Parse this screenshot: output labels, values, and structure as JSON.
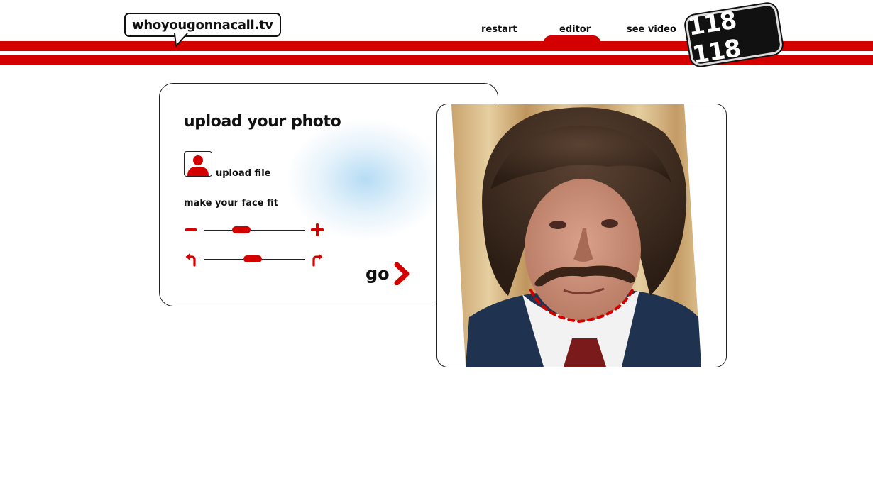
{
  "site": {
    "logo_text": "whoyougonnacall.tv",
    "badge_text": "118 118"
  },
  "nav": {
    "items": [
      {
        "label": "restart"
      },
      {
        "label": "editor"
      },
      {
        "label": "see video"
      }
    ]
  },
  "upload_panel": {
    "title": "upload your photo",
    "upload_label": "upload file",
    "fit_label": "make your face fit",
    "zoom_slider_value": 0.34,
    "rotate_slider_value": 0.48,
    "go_label": "go"
  },
  "colors": {
    "brand_red": "#d40000",
    "text": "#111111",
    "glow_blue": "#add8f3"
  },
  "icons": [
    "user-icon",
    "minus-icon",
    "plus-icon",
    "rotate-left-icon",
    "rotate-right-icon",
    "chevron-right-icon"
  ]
}
